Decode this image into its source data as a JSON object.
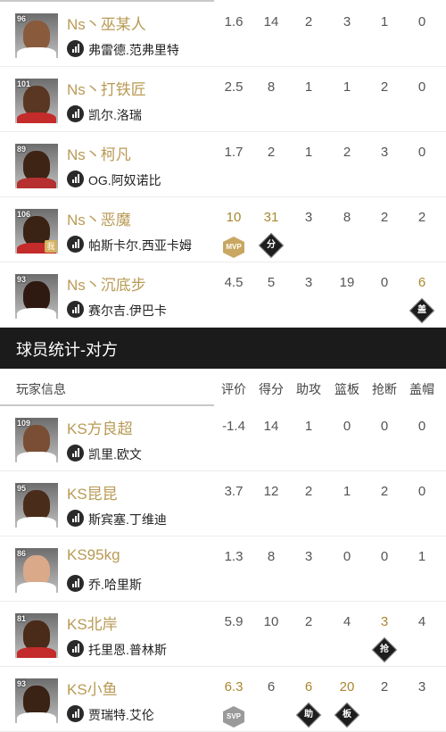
{
  "own_team": [
    {
      "ovr": "96",
      "name": "Ns丶巫某人",
      "real_name": "弗雷德.范弗里特",
      "me": "",
      "stats": [
        "1.6",
        "14",
        "2",
        "3",
        "1",
        "0"
      ],
      "gold": [],
      "badges": [],
      "skin": "#8a5a3c",
      "shirt": "#ffffff"
    },
    {
      "ovr": "101",
      "name": "Ns丶打铁匠",
      "real_name": "凯尔.洛瑞",
      "me": "",
      "stats": [
        "2.5",
        "8",
        "1",
        "1",
        "2",
        "0"
      ],
      "gold": [],
      "badges": [],
      "skin": "#5a3722",
      "shirt": "#c42b2b"
    },
    {
      "ovr": "89",
      "name": "Ns丶柯凡",
      "real_name": "OG.阿奴诺比",
      "me": "",
      "stats": [
        "1.7",
        "2",
        "1",
        "2",
        "3",
        "0"
      ],
      "gold": [],
      "badges": [],
      "skin": "#3e2415",
      "shirt": "#b63030"
    },
    {
      "ovr": "106",
      "name": "Ns丶恶魔",
      "real_name": "帕斯卡尔.西亚卡姆",
      "me": "我",
      "stats": [
        "10",
        "31",
        "3",
        "8",
        "2",
        "2"
      ],
      "gold": [
        0,
        1
      ],
      "badges": [
        {
          "col": 0,
          "type": "mvp",
          "text": "MVP"
        },
        {
          "col": 1,
          "type": "d",
          "text": "分"
        }
      ],
      "skin": "#3a2214",
      "shirt": "#c42b2b"
    },
    {
      "ovr": "93",
      "name": "Ns丶沉底步",
      "real_name": "赛尔吉.伊巴卡",
      "me": "",
      "stats": [
        "4.5",
        "5",
        "3",
        "19",
        "0",
        "6"
      ],
      "gold": [
        5
      ],
      "badges": [
        {
          "col": 5,
          "type": "d",
          "text": "盖"
        }
      ],
      "skin": "#2e1a10",
      "shirt": "#ffffff"
    }
  ],
  "section_title": "球员统计-对方",
  "headers": {
    "player_info": "玩家信息",
    "cols": [
      "评价",
      "得分",
      "助攻",
      "篮板",
      "抢断",
      "盖帽"
    ]
  },
  "opp_team": [
    {
      "ovr": "109",
      "name": "KS方良超",
      "real_name": "凯里.欧文",
      "me": "",
      "stats": [
        "-1.4",
        "14",
        "1",
        "0",
        "0",
        "0"
      ],
      "gold": [],
      "badges": [],
      "skin": "#7a4e34",
      "shirt": "#ffffff"
    },
    {
      "ovr": "95",
      "name": "KS昆昆",
      "real_name": "斯宾塞.丁维迪",
      "me": "",
      "stats": [
        "3.7",
        "12",
        "2",
        "1",
        "2",
        "0"
      ],
      "gold": [],
      "badges": [],
      "skin": "#4a2c1a",
      "shirt": "#ffffff"
    },
    {
      "ovr": "86",
      "name": "KS95kg",
      "real_name": "乔.哈里斯",
      "me": "",
      "stats": [
        "1.3",
        "8",
        "3",
        "0",
        "0",
        "1"
      ],
      "gold": [],
      "badges": [],
      "skin": "#d9a98a",
      "shirt": "#ffffff"
    },
    {
      "ovr": "81",
      "name": "KS北岸",
      "real_name": "托里恩.普林斯",
      "me": "",
      "stats": [
        "5.9",
        "10",
        "2",
        "4",
        "3",
        "4"
      ],
      "gold": [
        4
      ],
      "badges": [
        {
          "col": 4,
          "type": "d",
          "text": "抢"
        }
      ],
      "skin": "#4a2a18",
      "shirt": "#c42b2b"
    },
    {
      "ovr": "93",
      "name": "KS小鱼",
      "real_name": "贾瑞特.艾伦",
      "me": "",
      "stats": [
        "6.3",
        "6",
        "6",
        "20",
        "2",
        "3"
      ],
      "gold": [
        0,
        2,
        3
      ],
      "badges": [
        {
          "col": 0,
          "type": "svp",
          "text": "SVP"
        },
        {
          "col": 2,
          "type": "d",
          "text": "助"
        },
        {
          "col": 3,
          "type": "d",
          "text": "板"
        }
      ],
      "skin": "#3a2214",
      "shirt": "#ffffff"
    }
  ]
}
